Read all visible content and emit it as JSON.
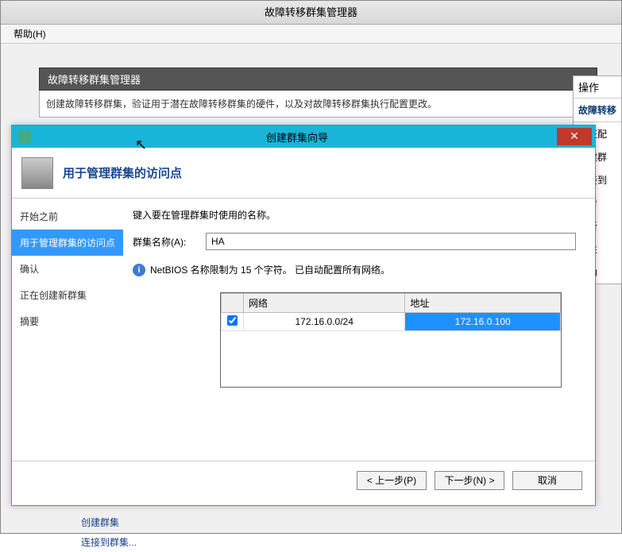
{
  "window": {
    "title": "故障转移群集管理器",
    "help_menu": "帮助(H)"
  },
  "panel": {
    "header": "故障转移群集管理器",
    "intro": "创建故障转移群集，验证用于潜在故障转移群集的硬件，以及对故障转移群集执行配置更改。"
  },
  "actions": {
    "head": "操作",
    "title": "故障转移",
    "items": [
      "验证配",
      "创建群",
      "连接到",
      "查看",
      "刷新",
      "属性",
      "帮助"
    ]
  },
  "wizard": {
    "title": "创建群集向导",
    "header_title": "用于管理群集的访问点",
    "steps": [
      "开始之前",
      "用于管理群集的访问点",
      "确认",
      "正在创建新群集",
      "摘要"
    ],
    "prompt": "键入要在管理群集时使用的名称。",
    "name_label": "群集名称(A):",
    "name_value": "HA",
    "info_text": "NetBIOS 名称限制为 15 个字符。  已自动配置所有网络。",
    "table": {
      "col_net": "网络",
      "col_addr": "地址",
      "rows": [
        {
          "checked": true,
          "network": "172.16.0.0/24",
          "address": "172.16.0.100"
        }
      ]
    },
    "buttons": {
      "back": "< 上一步(P)",
      "next": "下一步(N) >",
      "cancel": "取消"
    }
  },
  "bottom": {
    "link1": "创建群集",
    "link2": "连接到群集..."
  }
}
